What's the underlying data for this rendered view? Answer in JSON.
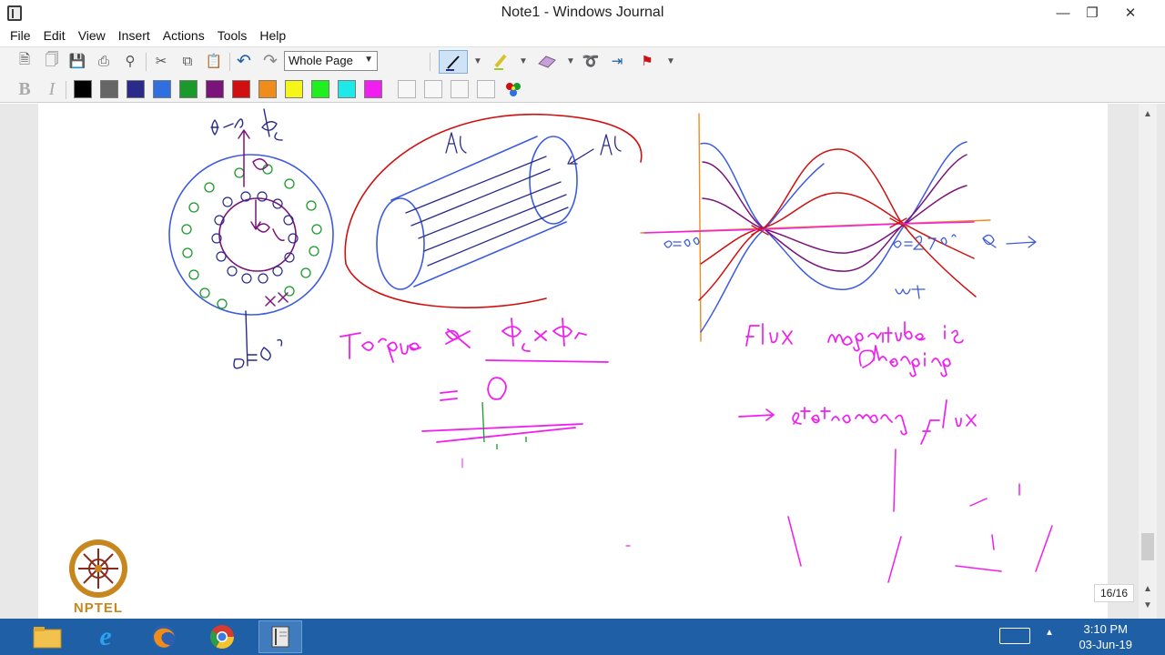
{
  "window": {
    "title": "Note1 - Windows Journal"
  },
  "menu": [
    "File",
    "Edit",
    "View",
    "Insert",
    "Actions",
    "Tools",
    "Help"
  ],
  "toolbar": {
    "zoom_value": "Whole Page",
    "pen_colors": [
      "#000000",
      "#666666",
      "#2a2a8a",
      "#2f6fe0",
      "#1a9a2a",
      "#7a137a",
      "#d01010",
      "#f08c1a",
      "#f5f51a",
      "#1ef01e",
      "#1ee8e8",
      "#f01ef0"
    ]
  },
  "page": {
    "counter": "16/16",
    "logo_text": "NPTEL"
  },
  "taskbar": {
    "time": "3:10 PM",
    "date": "03-Jun-19"
  }
}
